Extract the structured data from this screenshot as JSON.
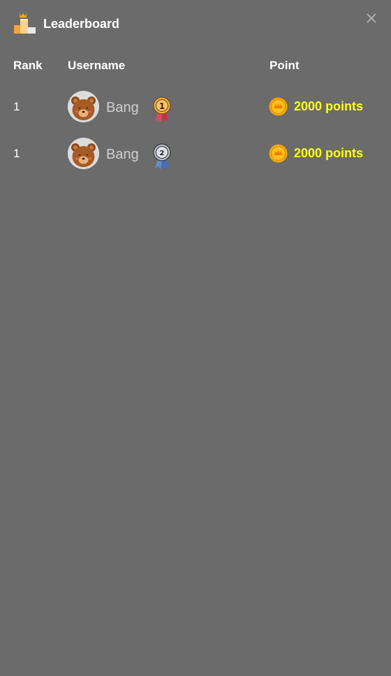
{
  "header": {
    "title": "Leaderboard",
    "icon": "podium-crown-icon",
    "close_icon": "close-icon"
  },
  "table": {
    "columns": [
      "Rank",
      "Username",
      "Point"
    ],
    "rows": [
      {
        "rank": "1",
        "username": "Bang",
        "avatar": "bear-avatar",
        "medal": "gold-medal-1",
        "medal_number": "1",
        "points": "2000 points",
        "points_icon": "crown-coin-icon"
      },
      {
        "rank": "1",
        "username": "Bang",
        "avatar": "bear-avatar",
        "medal": "silver-medal-2",
        "medal_number": "2",
        "points": "2000 points",
        "points_icon": "crown-coin-icon"
      }
    ]
  },
  "colors": {
    "background": "#6b6b6b",
    "points_text": "#ffff1a",
    "username_text": "#d0d0d0",
    "coin": "#f7a600"
  }
}
